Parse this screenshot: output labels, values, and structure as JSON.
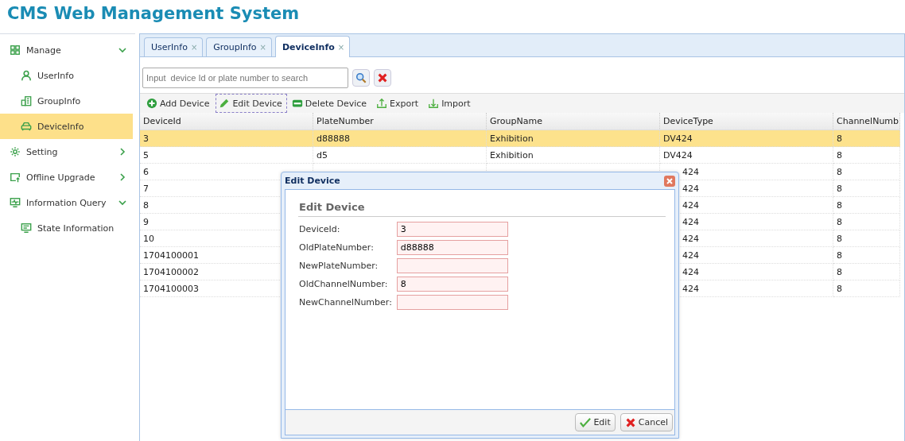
{
  "header": {
    "title": "CMS Web Management System"
  },
  "sidebar": {
    "items": [
      {
        "label": "Manage",
        "kind": "grid",
        "expanded": true,
        "selected": false,
        "children": [
          {
            "label": "UserInfo",
            "kind": "user",
            "selected": false
          },
          {
            "label": "GroupInfo",
            "kind": "group",
            "selected": false
          },
          {
            "label": "DeviceInfo",
            "kind": "car",
            "selected": true
          }
        ]
      },
      {
        "label": "Setting",
        "kind": "gear",
        "expanded": false,
        "selected": false
      },
      {
        "label": "Offline Upgrade",
        "kind": "upgrade",
        "expanded": false,
        "selected": false
      },
      {
        "label": "Information Query",
        "kind": "monitor",
        "expanded": true,
        "selected": false,
        "children": [
          {
            "label": "State Information",
            "kind": "screen",
            "selected": false
          }
        ]
      }
    ]
  },
  "tabs": [
    {
      "label": "UserInfo",
      "close": "×",
      "selected": false
    },
    {
      "label": "GroupInfo",
      "close": "×",
      "selected": false
    },
    {
      "label": "DeviceInfo",
      "close": "×",
      "selected": true
    }
  ],
  "search": {
    "placeholder": "Input  device Id or plate number to search"
  },
  "toolbar": [
    {
      "label": "Add Device",
      "kind": "add",
      "focused": false
    },
    {
      "label": "Edit Device",
      "kind": "edit",
      "focused": true
    },
    {
      "label": "Delete Device",
      "kind": "delete",
      "focused": false
    },
    {
      "label": "Export",
      "kind": "export",
      "focused": false
    },
    {
      "label": "Import",
      "kind": "import",
      "focused": false
    }
  ],
  "table": {
    "columns": [
      "DeviceId",
      "PlateNumber",
      "GroupName",
      "DeviceType",
      "ChannelNumb"
    ],
    "rows": [
      {
        "selected": true,
        "cells": [
          {
            "text": "3"
          },
          {
            "text": "d88888"
          },
          {
            "text": "Exhibition"
          },
          {
            "text": "DV424"
          },
          {
            "text": "8"
          }
        ]
      },
      {
        "selected": false,
        "cells": [
          {
            "text": "5"
          },
          {
            "text": "d5"
          },
          {
            "text": "Exhibition"
          },
          {
            "text": "DV424"
          },
          {
            "text": "8"
          }
        ]
      },
      {
        "selected": false,
        "cells": [
          {
            "text": "6"
          },
          {},
          {},
          {
            "text": "424",
            "clipped": true
          },
          {
            "text": "8"
          }
        ]
      },
      {
        "selected": false,
        "cells": [
          {
            "text": "7"
          },
          {},
          {},
          {
            "text": "424",
            "clipped": true
          },
          {
            "text": "8"
          }
        ]
      },
      {
        "selected": false,
        "cells": [
          {
            "text": "8"
          },
          {},
          {},
          {
            "text": "424",
            "clipped": true
          },
          {
            "text": "8"
          }
        ]
      },
      {
        "selected": false,
        "cells": [
          {
            "text": "9"
          },
          {},
          {},
          {
            "text": "424",
            "clipped": true
          },
          {
            "text": "8"
          }
        ]
      },
      {
        "selected": false,
        "cells": [
          {
            "text": "10"
          },
          {},
          {},
          {
            "text": "424",
            "clipped": true
          },
          {
            "text": "8"
          }
        ]
      },
      {
        "selected": false,
        "cells": [
          {
            "text": "1704100001"
          },
          {},
          {},
          {
            "text": "424",
            "clipped": true
          },
          {
            "text": "8"
          }
        ]
      },
      {
        "selected": false,
        "cells": [
          {
            "text": "1704100002"
          },
          {},
          {},
          {
            "text": "424",
            "clipped": true
          },
          {
            "text": "8"
          }
        ]
      },
      {
        "selected": false,
        "cells": [
          {
            "text": "1704100003"
          },
          {},
          {},
          {
            "text": "424",
            "clipped": true
          },
          {
            "text": "8"
          }
        ]
      }
    ]
  },
  "dialog": {
    "title": "Edit Device",
    "heading": "Edit Device",
    "fields": [
      {
        "label": "DeviceId:",
        "value": "3"
      },
      {
        "label": "OldPlateNumber:",
        "value": "d88888"
      },
      {
        "label": "NewPlateNumber:"
      },
      {
        "label": "OldChannelNumber:",
        "value": "8"
      },
      {
        "label": "NewChannelNumber:"
      }
    ],
    "buttons": [
      {
        "label": "Edit",
        "kind": "check"
      },
      {
        "label": "Cancel",
        "kind": "cross"
      }
    ]
  }
}
